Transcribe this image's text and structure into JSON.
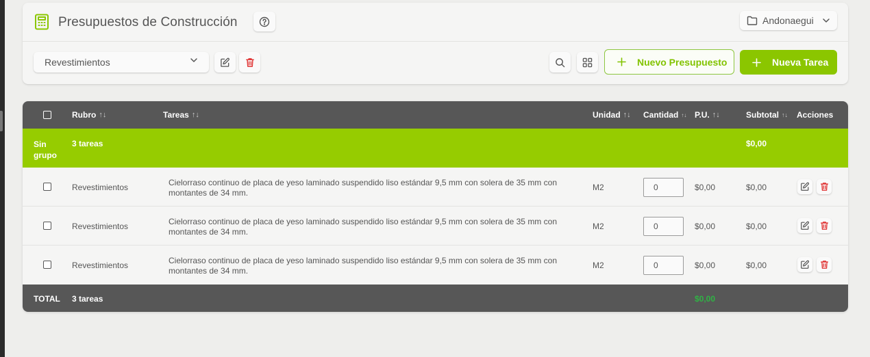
{
  "header": {
    "title": "Presupuestos de Construcción",
    "project": "Andonaegui"
  },
  "toolbar": {
    "selected_rubro": "Revestimientos",
    "new_budget_label": "Nuevo Presupuesto",
    "new_task_label": "Nueva Tarea"
  },
  "table": {
    "columns": [
      "Rubro",
      "Tareas",
      "Unidad",
      "Cantidad",
      "P.U.",
      "Subtotal",
      "Acciones"
    ],
    "group": {
      "label": "Sin grupo",
      "count": "3 tareas",
      "subtotal": "$0,00"
    },
    "rows": [
      {
        "rubro": "Revestimientos",
        "tarea": "Cielorraso continuo de placa de yeso laminado suspendido liso estándar 9,5 mm con solera de 35 mm con montantes de 34 mm.",
        "unidad": "M2",
        "cantidad": "0",
        "pu": "$0,00",
        "subtotal": "$0,00"
      },
      {
        "rubro": "Revestimientos",
        "tarea": "Cielorraso continuo de placa de yeso laminado suspendido liso estándar 9,5 mm con solera de 35 mm con montantes de 34 mm.",
        "unidad": "M2",
        "cantidad": "0",
        "pu": "$0,00",
        "subtotal": "$0,00"
      },
      {
        "rubro": "Revestimientos",
        "tarea": "Cielorraso continuo de placa de yeso laminado suspendido liso estándar 9,5 mm con solera de 35 mm con montantes de 34 mm.",
        "unidad": "M2",
        "cantidad": "0",
        "pu": "$0,00",
        "subtotal": "$0,00"
      }
    ],
    "footer": {
      "label": "TOTAL",
      "count": "3 tareas",
      "total": "$0,00"
    }
  },
  "colors": {
    "accent": "#8bc600",
    "group_row": "#96cc00",
    "header_bg": "#575757",
    "danger": "#e03131",
    "total_green": "#2fb344"
  },
  "icons": [
    "calculator-icon",
    "help-circle-icon",
    "folder-icon",
    "chevron-down-icon",
    "edit-icon",
    "trash-icon",
    "search-icon",
    "grid-icon",
    "plus-icon",
    "sort-icon"
  ]
}
